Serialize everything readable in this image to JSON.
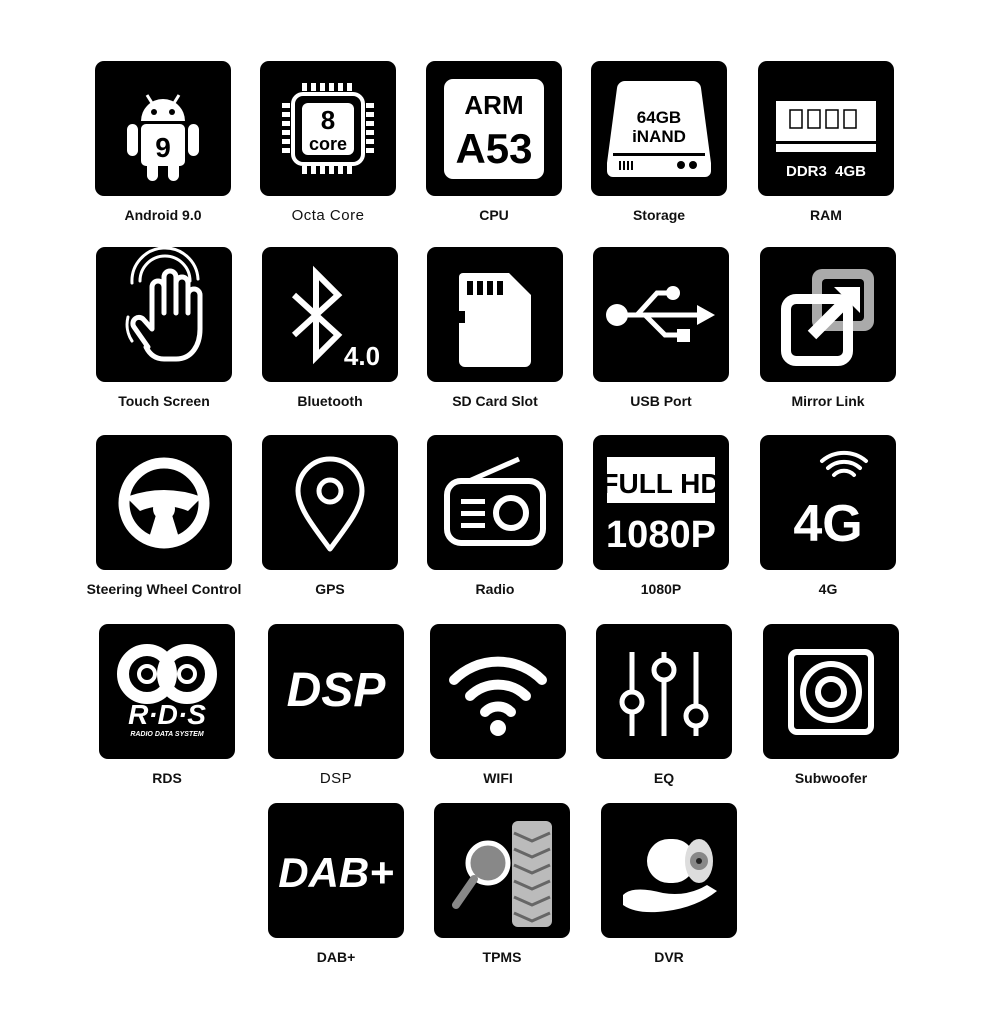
{
  "features": [
    {
      "label": "Android 9.0",
      "icon": "android-icon",
      "icon_text": [
        "9"
      ]
    },
    {
      "label": "Octa Core",
      "icon": "octa-core-chip-icon",
      "icon_text": [
        "8",
        "core"
      ]
    },
    {
      "label": "CPU",
      "icon": "cpu-icon",
      "icon_text": [
        "ARM",
        "A53"
      ]
    },
    {
      "label": "Storage",
      "icon": "storage-drive-icon",
      "icon_text": [
        "64GB",
        "iNAND"
      ]
    },
    {
      "label": "RAM",
      "icon": "ram-module-icon",
      "icon_text": [
        "DDR3  4GB"
      ]
    },
    {
      "label": "Touch Screen",
      "icon": "touch-hand-icon",
      "icon_text": []
    },
    {
      "label": "Bluetooth",
      "icon": "bluetooth-icon",
      "icon_text": [
        "4.0"
      ]
    },
    {
      "label": "SD Card Slot",
      "icon": "sd-card-icon",
      "icon_text": []
    },
    {
      "label": "USB Port",
      "icon": "usb-icon",
      "icon_text": []
    },
    {
      "label": "Mirror Link",
      "icon": "mirror-link-icon",
      "icon_text": []
    },
    {
      "label": "Steering Wheel Control",
      "icon": "steering-wheel-icon",
      "icon_text": []
    },
    {
      "label": "GPS",
      "icon": "gps-pin-icon",
      "icon_text": []
    },
    {
      "label": "Radio",
      "icon": "radio-icon",
      "icon_text": []
    },
    {
      "label": "1080P",
      "icon": "full-hd-icon",
      "icon_text": [
        "FULL HD",
        "1080P"
      ]
    },
    {
      "label": "4G",
      "icon": "4g-signal-icon",
      "icon_text": [
        "4G"
      ]
    },
    {
      "label": "RDS",
      "icon": "rds-logo-icon",
      "icon_text": [
        "R·D·S",
        "RADIO DATA SYSTEM"
      ]
    },
    {
      "label": "DSP",
      "icon": "dsp-icon",
      "icon_text": [
        "DSP"
      ]
    },
    {
      "label": "WIFI",
      "icon": "wifi-icon",
      "icon_text": []
    },
    {
      "label": "EQ",
      "icon": "equalizer-icon",
      "icon_text": []
    },
    {
      "label": "Subwoofer",
      "icon": "subwoofer-icon",
      "icon_text": []
    },
    {
      "label": "DAB+",
      "icon": "dab-plus-icon",
      "icon_text": [
        "DAB+"
      ]
    },
    {
      "label": "TPMS",
      "icon": "tpms-tire-magnifier-icon",
      "icon_text": []
    },
    {
      "label": "DVR",
      "icon": "dvr-camera-icon",
      "icon_text": []
    }
  ],
  "colors": {
    "tile": "#000000",
    "icon": "#ffffff",
    "accent_gray": "#aaaaaa",
    "label": "#111111"
  }
}
